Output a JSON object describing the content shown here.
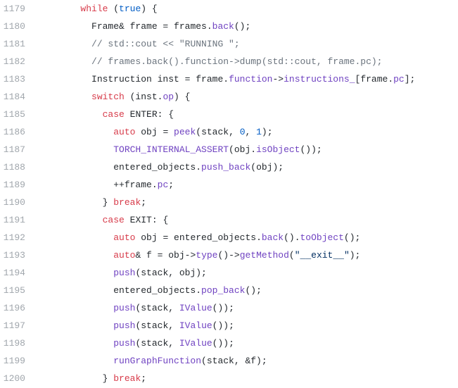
{
  "lines": [
    {
      "num": "1179",
      "indent": 8,
      "tokens": [
        {
          "t": "keyword",
          "v": "while"
        },
        {
          "t": "plain",
          "v": " ("
        },
        {
          "t": "constant",
          "v": "true"
        },
        {
          "t": "plain",
          "v": ") {"
        }
      ]
    },
    {
      "num": "1180",
      "indent": 10,
      "tokens": [
        {
          "t": "plain",
          "v": "Frame& frame = frames."
        },
        {
          "t": "function",
          "v": "back"
        },
        {
          "t": "plain",
          "v": "();"
        }
      ]
    },
    {
      "num": "1181",
      "indent": 10,
      "tokens": [
        {
          "t": "comment",
          "v": "// std::cout << \"RUNNING \";"
        }
      ]
    },
    {
      "num": "1182",
      "indent": 10,
      "tokens": [
        {
          "t": "comment",
          "v": "// frames.back().function->dump(std::cout, frame.pc);"
        }
      ]
    },
    {
      "num": "1183",
      "indent": 10,
      "tokens": [
        {
          "t": "plain",
          "v": "Instruction inst = frame."
        },
        {
          "t": "function",
          "v": "function"
        },
        {
          "t": "plain",
          "v": "->"
        },
        {
          "t": "function",
          "v": "instructions_"
        },
        {
          "t": "plain",
          "v": "[frame."
        },
        {
          "t": "function",
          "v": "pc"
        },
        {
          "t": "plain",
          "v": "];"
        }
      ]
    },
    {
      "num": "1184",
      "indent": 10,
      "tokens": [
        {
          "t": "keyword",
          "v": "switch"
        },
        {
          "t": "plain",
          "v": " (inst."
        },
        {
          "t": "function",
          "v": "op"
        },
        {
          "t": "plain",
          "v": ") {"
        }
      ]
    },
    {
      "num": "1185",
      "indent": 12,
      "tokens": [
        {
          "t": "keyword",
          "v": "case"
        },
        {
          "t": "plain",
          "v": " ENTER: {"
        }
      ]
    },
    {
      "num": "1186",
      "indent": 14,
      "tokens": [
        {
          "t": "keyword",
          "v": "auto"
        },
        {
          "t": "plain",
          "v": " obj = "
        },
        {
          "t": "function",
          "v": "peek"
        },
        {
          "t": "plain",
          "v": "(stack, "
        },
        {
          "t": "number",
          "v": "0"
        },
        {
          "t": "plain",
          "v": ", "
        },
        {
          "t": "number",
          "v": "1"
        },
        {
          "t": "plain",
          "v": ");"
        }
      ]
    },
    {
      "num": "1187",
      "indent": 14,
      "tokens": [
        {
          "t": "function",
          "v": "TORCH_INTERNAL_ASSERT"
        },
        {
          "t": "plain",
          "v": "(obj."
        },
        {
          "t": "function",
          "v": "isObject"
        },
        {
          "t": "plain",
          "v": "());"
        }
      ]
    },
    {
      "num": "1188",
      "indent": 14,
      "tokens": [
        {
          "t": "plain",
          "v": "entered_objects."
        },
        {
          "t": "function",
          "v": "push_back"
        },
        {
          "t": "plain",
          "v": "(obj);"
        }
      ]
    },
    {
      "num": "1189",
      "indent": 14,
      "tokens": [
        {
          "t": "plain",
          "v": "++frame."
        },
        {
          "t": "function",
          "v": "pc"
        },
        {
          "t": "plain",
          "v": ";"
        }
      ]
    },
    {
      "num": "1190",
      "indent": 12,
      "tokens": [
        {
          "t": "plain",
          "v": "} "
        },
        {
          "t": "keyword",
          "v": "break"
        },
        {
          "t": "plain",
          "v": ";"
        }
      ]
    },
    {
      "num": "1191",
      "indent": 12,
      "tokens": [
        {
          "t": "keyword",
          "v": "case"
        },
        {
          "t": "plain",
          "v": " EXIT: {"
        }
      ]
    },
    {
      "num": "1192",
      "indent": 14,
      "tokens": [
        {
          "t": "keyword",
          "v": "auto"
        },
        {
          "t": "plain",
          "v": " obj = entered_objects."
        },
        {
          "t": "function",
          "v": "back"
        },
        {
          "t": "plain",
          "v": "()."
        },
        {
          "t": "function",
          "v": "toObject"
        },
        {
          "t": "plain",
          "v": "();"
        }
      ]
    },
    {
      "num": "1193",
      "indent": 14,
      "tokens": [
        {
          "t": "keyword",
          "v": "auto"
        },
        {
          "t": "plain",
          "v": "& f = obj->"
        },
        {
          "t": "function",
          "v": "type"
        },
        {
          "t": "plain",
          "v": "()->"
        },
        {
          "t": "function",
          "v": "getMethod"
        },
        {
          "t": "plain",
          "v": "("
        },
        {
          "t": "string",
          "v": "\"__exit__\""
        },
        {
          "t": "plain",
          "v": ");"
        }
      ]
    },
    {
      "num": "1194",
      "indent": 14,
      "tokens": [
        {
          "t": "function",
          "v": "push"
        },
        {
          "t": "plain",
          "v": "(stack, obj);"
        }
      ]
    },
    {
      "num": "1195",
      "indent": 14,
      "tokens": [
        {
          "t": "plain",
          "v": "entered_objects."
        },
        {
          "t": "function",
          "v": "pop_back"
        },
        {
          "t": "plain",
          "v": "();"
        }
      ]
    },
    {
      "num": "1196",
      "indent": 14,
      "tokens": [
        {
          "t": "function",
          "v": "push"
        },
        {
          "t": "plain",
          "v": "(stack, "
        },
        {
          "t": "function",
          "v": "IValue"
        },
        {
          "t": "plain",
          "v": "());"
        }
      ]
    },
    {
      "num": "1197",
      "indent": 14,
      "tokens": [
        {
          "t": "function",
          "v": "push"
        },
        {
          "t": "plain",
          "v": "(stack, "
        },
        {
          "t": "function",
          "v": "IValue"
        },
        {
          "t": "plain",
          "v": "());"
        }
      ]
    },
    {
      "num": "1198",
      "indent": 14,
      "tokens": [
        {
          "t": "function",
          "v": "push"
        },
        {
          "t": "plain",
          "v": "(stack, "
        },
        {
          "t": "function",
          "v": "IValue"
        },
        {
          "t": "plain",
          "v": "());"
        }
      ]
    },
    {
      "num": "1199",
      "indent": 14,
      "tokens": [
        {
          "t": "function",
          "v": "runGraphFunction"
        },
        {
          "t": "plain",
          "v": "(stack, &f);"
        }
      ]
    },
    {
      "num": "1200",
      "indent": 12,
      "tokens": [
        {
          "t": "plain",
          "v": "} "
        },
        {
          "t": "keyword",
          "v": "break"
        },
        {
          "t": "plain",
          "v": ";"
        }
      ]
    }
  ]
}
